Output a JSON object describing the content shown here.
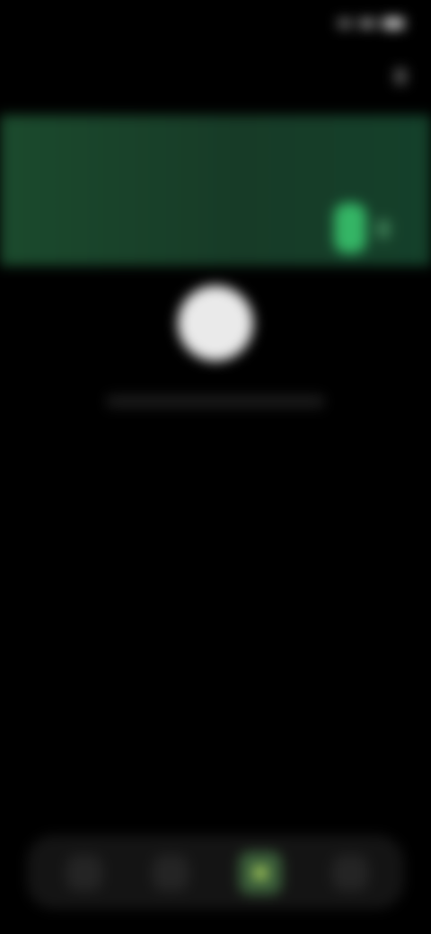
{
  "status_bar": {
    "time": "",
    "icons": [
      "signal-icon",
      "wifi-icon",
      "battery-icon"
    ]
  },
  "header": {
    "title": "",
    "icon": "more-vertical-icon"
  },
  "hero_card": {
    "text": "",
    "action_icon": "toggle-icon",
    "colors": {
      "background": "#1b4a2d",
      "accent": "#34b565"
    }
  },
  "center": {
    "icon": "avatar-circle",
    "caption": ""
  },
  "bottom_nav": {
    "items": [
      {
        "icon": "nav-icon-1",
        "active": false
      },
      {
        "icon": "nav-icon-2",
        "active": false
      },
      {
        "icon": "nav-icon-3",
        "active": true
      },
      {
        "icon": "nav-icon-4",
        "active": false
      }
    ],
    "active_color": "#a8cc5a"
  }
}
